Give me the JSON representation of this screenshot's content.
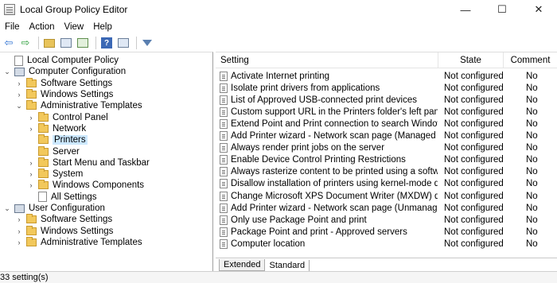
{
  "window": {
    "title": "Local Group Policy Editor",
    "minimize": "—",
    "maximize": "☐",
    "close": "✕"
  },
  "menu": [
    "File",
    "Action",
    "View",
    "Help"
  ],
  "toolbar": {
    "back": "⇦",
    "forward": "⇨"
  },
  "tree": [
    {
      "label": "Local Computer Policy",
      "level": 0,
      "toggle": "",
      "icon": "doc"
    },
    {
      "label": "Computer Configuration",
      "level": 0,
      "toggle": "⌄",
      "icon": "pc"
    },
    {
      "label": "Software Settings",
      "level": 1,
      "toggle": "›",
      "icon": "folder"
    },
    {
      "label": "Windows Settings",
      "level": 1,
      "toggle": "›",
      "icon": "folder"
    },
    {
      "label": "Administrative Templates",
      "level": 1,
      "toggle": "⌄",
      "icon": "folder"
    },
    {
      "label": "Control Panel",
      "level": 2,
      "toggle": "›",
      "icon": "folder"
    },
    {
      "label": "Network",
      "level": 2,
      "toggle": "›",
      "icon": "folder"
    },
    {
      "label": "Printers",
      "level": 2,
      "toggle": "",
      "icon": "folder",
      "selected": true
    },
    {
      "label": "Server",
      "level": 2,
      "toggle": "",
      "icon": "folder"
    },
    {
      "label": "Start Menu and Taskbar",
      "level": 2,
      "toggle": "›",
      "icon": "folder"
    },
    {
      "label": "System",
      "level": 2,
      "toggle": "›",
      "icon": "folder"
    },
    {
      "label": "Windows Components",
      "level": 2,
      "toggle": "›",
      "icon": "folder"
    },
    {
      "label": "All Settings",
      "level": 2,
      "toggle": "",
      "icon": "doc"
    },
    {
      "label": "User Configuration",
      "level": 0,
      "toggle": "⌄",
      "icon": "pc"
    },
    {
      "label": "Software Settings",
      "level": 1,
      "toggle": "›",
      "icon": "folder"
    },
    {
      "label": "Windows Settings",
      "level": 1,
      "toggle": "›",
      "icon": "folder"
    },
    {
      "label": "Administrative Templates",
      "level": 1,
      "toggle": "›",
      "icon": "folder"
    }
  ],
  "columns": {
    "setting": "Setting",
    "state": "State",
    "comment": "Comment"
  },
  "rows": [
    {
      "setting": "Activate Internet printing",
      "state": "Not configured",
      "comment": "No"
    },
    {
      "setting": "Isolate print drivers from applications",
      "state": "Not configured",
      "comment": "No"
    },
    {
      "setting": "List of Approved USB-connected print devices",
      "state": "Not configured",
      "comment": "No"
    },
    {
      "setting": "Custom support URL in the Printers folder's left pane",
      "state": "Not configured",
      "comment": "No"
    },
    {
      "setting": "Extend Point and Print connection to search Windows Update",
      "state": "Not configured",
      "comment": "No"
    },
    {
      "setting": "Add Printer wizard - Network scan page (Managed network)",
      "state": "Not configured",
      "comment": "No"
    },
    {
      "setting": "Always render print jobs on the server",
      "state": "Not configured",
      "comment": "No"
    },
    {
      "setting": "Enable Device Control Printing Restrictions",
      "state": "Not configured",
      "comment": "No"
    },
    {
      "setting": "Always rasterize content to be printed using a software raste...",
      "state": "Not configured",
      "comment": "No"
    },
    {
      "setting": "Disallow installation of printers using kernel-mode drivers",
      "state": "Not configured",
      "comment": "No"
    },
    {
      "setting": "Change Microsoft XPS Document Writer (MXDW) default ou...",
      "state": "Not configured",
      "comment": "No"
    },
    {
      "setting": "Add Printer wizard - Network scan page (Unmanaged netwo...",
      "state": "Not configured",
      "comment": "No"
    },
    {
      "setting": "Only use Package Point and print",
      "state": "Not configured",
      "comment": "No"
    },
    {
      "setting": "Package Point and print - Approved servers",
      "state": "Not configured",
      "comment": "No"
    },
    {
      "setting": "Computer location",
      "state": "Not configured",
      "comment": "No"
    }
  ],
  "tabs": [
    "Extended",
    "Standard"
  ],
  "status": "33 setting(s)"
}
